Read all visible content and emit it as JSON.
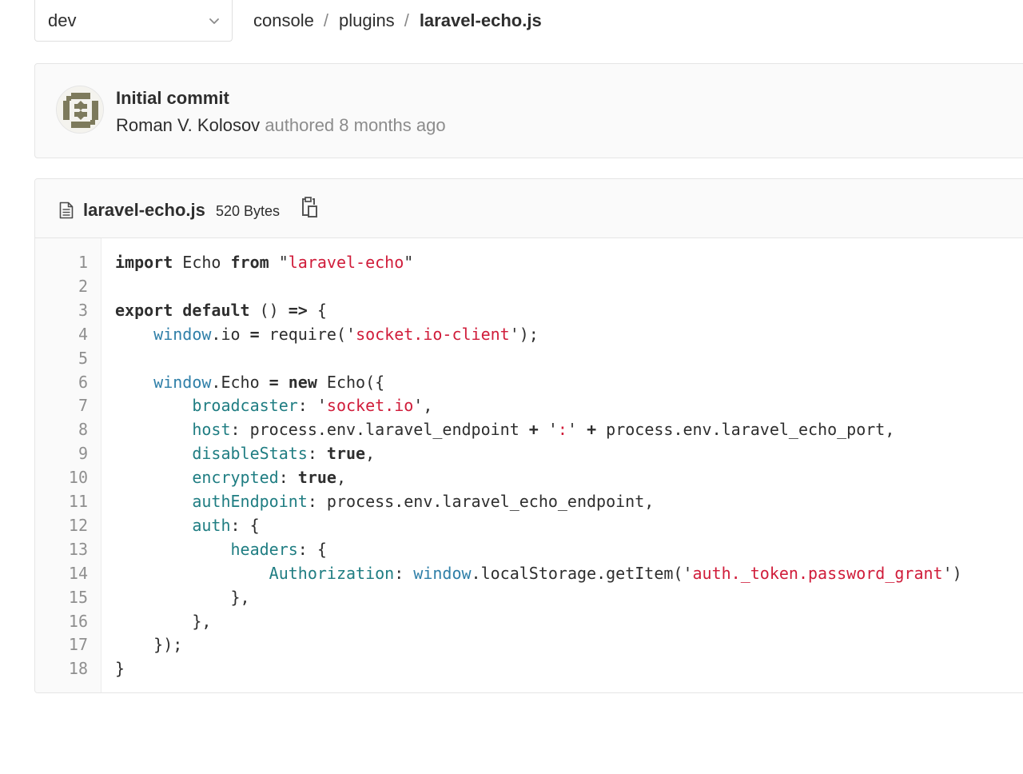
{
  "branch_selector": {
    "value": "dev"
  },
  "breadcrumb": [
    {
      "label": "console",
      "current": false
    },
    {
      "label": "plugins",
      "current": false
    },
    {
      "label": "laravel-echo.js",
      "current": true
    }
  ],
  "breadcrumb_separator": "/",
  "commit": {
    "title": "Initial commit",
    "author": "Roman V. Kolosov",
    "meta": "authored 8 months ago"
  },
  "file": {
    "name": "laravel-echo.js",
    "size": "520 Bytes",
    "icons": {
      "file": "file-text-icon",
      "copy": "clipboard-copy-icon"
    }
  },
  "colors": {
    "keyword": "#2e2e2e",
    "string": "#d01c3a",
    "builtin": "#2f7fa8",
    "property": "#1f7d82",
    "line_number": "#8f8f8f"
  },
  "code": [
    {
      "n": "1",
      "tokens": [
        [
          "kw",
          "import"
        ],
        [
          "t",
          " Echo "
        ],
        [
          "kw",
          "from"
        ],
        [
          "t",
          " \""
        ],
        [
          "str",
          "laravel-echo"
        ],
        [
          "t",
          "\""
        ]
      ]
    },
    {
      "n": "2",
      "tokens": []
    },
    {
      "n": "3",
      "tokens": [
        [
          "kw",
          "export"
        ],
        [
          "t",
          " "
        ],
        [
          "kw",
          "default"
        ],
        [
          "t",
          " () "
        ],
        [
          "op",
          "=>"
        ],
        [
          "t",
          " {"
        ]
      ]
    },
    {
      "n": "4",
      "tokens": [
        [
          "t",
          "    "
        ],
        [
          "bi",
          "window"
        ],
        [
          "t",
          ".io "
        ],
        [
          "op",
          "="
        ],
        [
          "t",
          " require('"
        ],
        [
          "str",
          "socket.io-client"
        ],
        [
          "t",
          "');"
        ]
      ]
    },
    {
      "n": "5",
      "tokens": []
    },
    {
      "n": "6",
      "tokens": [
        [
          "t",
          "    "
        ],
        [
          "bi",
          "window"
        ],
        [
          "t",
          ".Echo "
        ],
        [
          "op",
          "="
        ],
        [
          "t",
          " "
        ],
        [
          "kw",
          "new"
        ],
        [
          "t",
          " Echo({"
        ]
      ]
    },
    {
      "n": "7",
      "tokens": [
        [
          "t",
          "        "
        ],
        [
          "prop",
          "broadcaster"
        ],
        [
          "t",
          ": '"
        ],
        [
          "str",
          "socket.io"
        ],
        [
          "t",
          "',"
        ]
      ]
    },
    {
      "n": "8",
      "tokens": [
        [
          "t",
          "        "
        ],
        [
          "prop",
          "host"
        ],
        [
          "t",
          ": process.env.laravel_endpoint "
        ],
        [
          "op",
          "+"
        ],
        [
          "t",
          " '"
        ],
        [
          "str",
          ":"
        ],
        [
          "t",
          "' "
        ],
        [
          "op",
          "+"
        ],
        [
          "t",
          " process.env.laravel_echo_port,"
        ]
      ]
    },
    {
      "n": "9",
      "tokens": [
        [
          "t",
          "        "
        ],
        [
          "prop",
          "disableStats"
        ],
        [
          "t",
          ": "
        ],
        [
          "kw",
          "true"
        ],
        [
          "t",
          ","
        ]
      ]
    },
    {
      "n": "10",
      "tokens": [
        [
          "t",
          "        "
        ],
        [
          "prop",
          "encrypted"
        ],
        [
          "t",
          ": "
        ],
        [
          "kw",
          "true"
        ],
        [
          "t",
          ","
        ]
      ]
    },
    {
      "n": "11",
      "tokens": [
        [
          "t",
          "        "
        ],
        [
          "prop",
          "authEndpoint"
        ],
        [
          "t",
          ": process.env.laravel_echo_endpoint,"
        ]
      ]
    },
    {
      "n": "12",
      "tokens": [
        [
          "t",
          "        "
        ],
        [
          "prop",
          "auth"
        ],
        [
          "t",
          ": {"
        ]
      ]
    },
    {
      "n": "13",
      "tokens": [
        [
          "t",
          "            "
        ],
        [
          "prop",
          "headers"
        ],
        [
          "t",
          ": {"
        ]
      ]
    },
    {
      "n": "14",
      "tokens": [
        [
          "t",
          "                "
        ],
        [
          "prop",
          "Authorization"
        ],
        [
          "t",
          ": "
        ],
        [
          "bi",
          "window"
        ],
        [
          "t",
          ".localStorage.getItem('"
        ],
        [
          "str",
          "auth._token.password_grant"
        ],
        [
          "t",
          "')"
        ]
      ]
    },
    {
      "n": "15",
      "tokens": [
        [
          "t",
          "            },"
        ]
      ]
    },
    {
      "n": "16",
      "tokens": [
        [
          "t",
          "        },"
        ]
      ]
    },
    {
      "n": "17",
      "tokens": [
        [
          "t",
          "    });"
        ]
      ]
    },
    {
      "n": "18",
      "tokens": [
        [
          "t",
          "}"
        ]
      ]
    }
  ]
}
